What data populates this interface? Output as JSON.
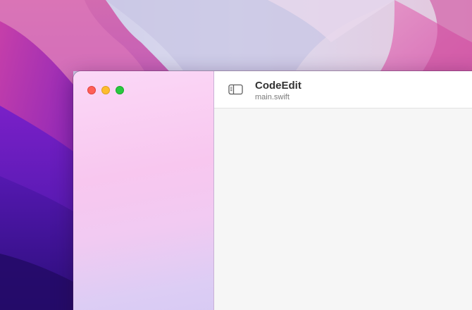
{
  "window": {
    "title": "CodeEdit",
    "subtitle": "main.swift"
  },
  "icons": {
    "sidebar_toggle": "sidebar-left-icon"
  },
  "colors": {
    "close": "#ff5f57",
    "minimize": "#febc2e",
    "zoom": "#28c840"
  }
}
